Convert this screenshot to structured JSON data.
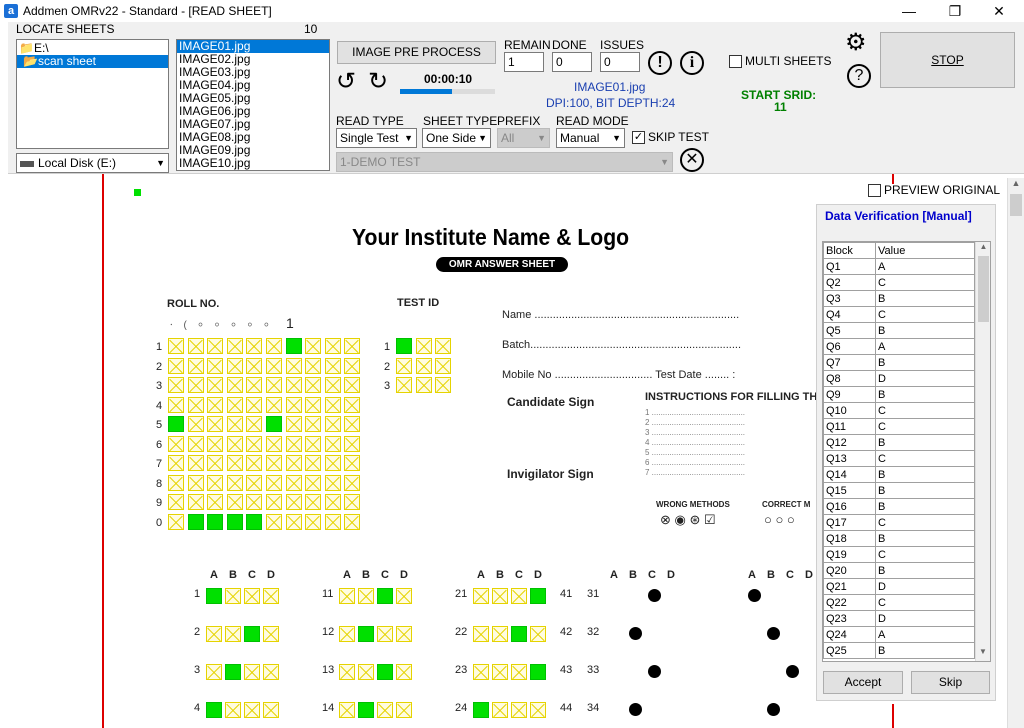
{
  "window": {
    "title": "Addmen OMRv22 - Standard - [READ SHEET]",
    "icon": "a",
    "minimize": "—",
    "maximize": "❐",
    "close": "✕"
  },
  "locate": {
    "label": "LOCATE SHEETS",
    "count": "10",
    "folders": [
      "E:\\",
      "scan sheet"
    ],
    "drive": "Local Disk (E:)"
  },
  "files": [
    "IMAGE01.jpg",
    "IMAGE02.jpg",
    "IMAGE03.jpg",
    "IMAGE04.jpg",
    "IMAGE05.jpg",
    "IMAGE06.jpg",
    "IMAGE07.jpg",
    "IMAGE08.jpg",
    "IMAGE09.jpg",
    "IMAGE10.jpg"
  ],
  "controls": {
    "preprocess": "IMAGE PRE PROCESS",
    "timer": "00:00:10",
    "remain_label": "REMAIN",
    "remain": "1",
    "done_label": "DONE",
    "done": "0",
    "issues_label": "ISSUES",
    "issues": "0",
    "current_image": "IMAGE01.jpg",
    "dpi": "DPI:100, BIT DEPTH:24",
    "read_type_label": "READ TYPE",
    "read_type": "Single Test",
    "sheet_type_label": "SHEET TYPE",
    "sheet_type": "One Side",
    "prefix_label": "PREFIX",
    "prefix": "All",
    "read_mode_label": "READ MODE",
    "read_mode": "Manual",
    "skip_test": "SKIP TEST",
    "test_name": "1-DEMO TEST",
    "multi_sheets": "MULTI SHEETS",
    "start_srid_label": "START SRID:",
    "start_srid": "11",
    "stop": "STOP",
    "preview": "PREVIEW ORIGINAL",
    "progress": 0.55
  },
  "sheet": {
    "institute": "Your Institute Name & Logo",
    "omr_title": "OMR ANSWER SHEET",
    "roll_label": "ROLL NO.",
    "test_label": "TEST ID",
    "roll_written": "1",
    "name": "Name",
    "batch": "Batch",
    "mobile": "Mobile No",
    "test_date": "Test Date",
    "candidate_sign": "Candidate Sign",
    "invigilator_sign": "Invigilator Sign",
    "instructions": "INSTRUCTIONS FOR FILLING THE",
    "wrong": "WRONG METHODS",
    "correct": "CORRECT M",
    "digits": [
      "1",
      "2",
      "3",
      "4",
      "5",
      "6",
      "7",
      "8",
      "9",
      "0"
    ],
    "test_digits": [
      "1",
      "2",
      "3"
    ],
    "options": [
      "A",
      "B",
      "C",
      "D"
    ]
  },
  "verification": {
    "title": "Data Verification [Manual]",
    "col_block": "Block",
    "col_value": "Value",
    "rows": [
      [
        "Q1",
        "A"
      ],
      [
        "Q2",
        "C"
      ],
      [
        "Q3",
        "B"
      ],
      [
        "Q4",
        "C"
      ],
      [
        "Q5",
        "B"
      ],
      [
        "Q6",
        "A"
      ],
      [
        "Q7",
        "B"
      ],
      [
        "Q8",
        "D"
      ],
      [
        "Q9",
        "B"
      ],
      [
        "Q10",
        "C"
      ],
      [
        "Q11",
        "C"
      ],
      [
        "Q12",
        "B"
      ],
      [
        "Q13",
        "C"
      ],
      [
        "Q14",
        "B"
      ],
      [
        "Q15",
        "B"
      ],
      [
        "Q16",
        "B"
      ],
      [
        "Q17",
        "C"
      ],
      [
        "Q18",
        "B"
      ],
      [
        "Q19",
        "C"
      ],
      [
        "Q20",
        "B"
      ],
      [
        "Q21",
        "D"
      ],
      [
        "Q22",
        "C"
      ],
      [
        "Q23",
        "D"
      ],
      [
        "Q24",
        "A"
      ],
      [
        "Q25",
        "B"
      ]
    ],
    "accept": "Accept",
    "skip": "Skip"
  },
  "colors": {
    "accent": "#0078d7",
    "fill": "#00e000",
    "bubble": "#e5d300",
    "srid": "#008000",
    "panel_title": "#0000cc",
    "red_line": "#d00000"
  }
}
